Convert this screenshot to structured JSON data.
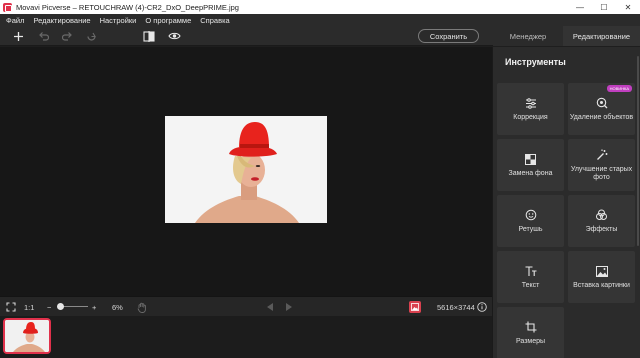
{
  "window": {
    "title": "Movavi Picverse – RETOUCHRAW (4)-CR2_DxO_DeepPRIME.jpg",
    "controls": {
      "minimize": "—",
      "maximize": "☐",
      "close": "✕"
    }
  },
  "menu": {
    "items": [
      "Файл",
      "Редактирование",
      "Настройки",
      "О программе",
      "Справка"
    ]
  },
  "toolbar": {
    "save_label": "Сохранить",
    "tabs": {
      "manager": "Менеджер",
      "edit": "Редактирование"
    },
    "active_tab": "edit",
    "icons": [
      "plus-icon",
      "undo-icon",
      "redo-icon",
      "reset-icon",
      "compare-icon",
      "eye-icon"
    ]
  },
  "bottom": {
    "zoom_ratio": "1:1",
    "zoom_percent": "6%",
    "dimensions": "5616×3744",
    "slider_level": 0.06
  },
  "panel": {
    "title": "Инструменты",
    "tools": [
      {
        "name": "correction",
        "label": "Коррекция",
        "icon": "sliders-icon"
      },
      {
        "name": "object-removal",
        "label": "Удаление объектов",
        "icon": "eraser-icon",
        "badge": "НОВИНКА"
      },
      {
        "name": "background-replace",
        "label": "Замена фона",
        "icon": "background-icon"
      },
      {
        "name": "old-photo-enhance",
        "label": "Улучшение старых фото",
        "icon": "magic-wand-icon"
      },
      {
        "name": "retouch",
        "label": "Ретушь",
        "icon": "face-icon"
      },
      {
        "name": "effects",
        "label": "Эффекты",
        "icon": "effects-icon"
      },
      {
        "name": "text",
        "label": "Текст",
        "icon": "text-icon"
      },
      {
        "name": "insert-image",
        "label": "Вставка картинки",
        "icon": "image-icon"
      },
      {
        "name": "resize",
        "label": "Размеры",
        "icon": "crop-icon"
      }
    ]
  },
  "colors": {
    "accent": "#e0314b",
    "badge": "#c03fbf",
    "panel_bg": "#2b2b2b",
    "canvas_bg": "#171717"
  }
}
